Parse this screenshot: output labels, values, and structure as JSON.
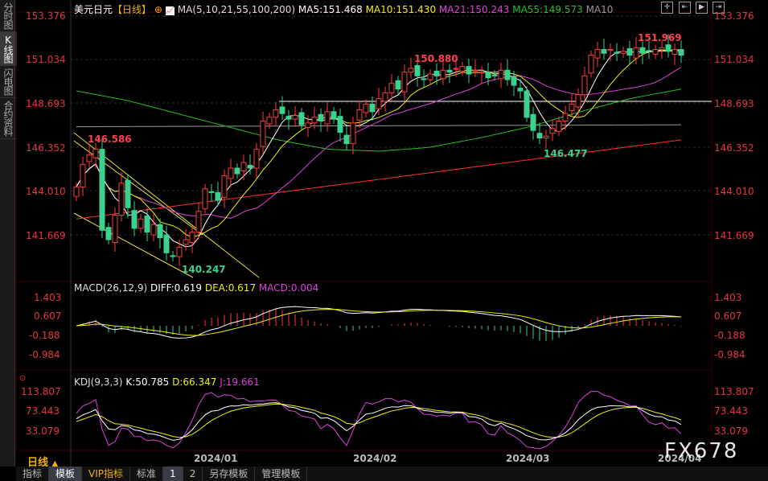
{
  "sidebar": {
    "tabs": [
      "分时图",
      "K线图",
      "闪电图",
      "合约资料"
    ],
    "active": 1
  },
  "header": {
    "symbol": "美元日元",
    "period": "【日线】",
    "ma_label": "MA(5,10,21,55,100,200)",
    "ma5": "MA5:151.468",
    "ma10": "MA10:151.430",
    "ma21": "MA21:150.243",
    "ma55": "MA55:149.573",
    "ma10b": "MA10"
  },
  "price_axis": [
    "153.376",
    "151.034",
    "148.693",
    "146.352",
    "144.010",
    "141.669"
  ],
  "annotations": {
    "high1": "146.586",
    "low1": "140.247",
    "high2": "150.880",
    "low2": "146.477",
    "high3": "151.969"
  },
  "macd": {
    "label": "MACD(26,12,9)",
    "diff": "DIFF:0.619",
    "dea": "DEA:0.617",
    "macd": "MACD:0.004",
    "axis": [
      "1.403",
      "0.607",
      "-0.188",
      "-0.984"
    ]
  },
  "kdj": {
    "label": "KDJ(9,3,3)",
    "k": "K:50.785",
    "d": "D:66.347",
    "j": "J:19.661",
    "axis": [
      "113.807",
      "73.443",
      "33.079"
    ]
  },
  "xaxis": [
    "2024/01",
    "2024/02",
    "2024/03",
    "2024/04"
  ],
  "period_button": "日线",
  "bottom_tabs": [
    "指标",
    "模板",
    "VIP指标",
    "标准",
    "1",
    "2",
    "另存模板",
    "管理模板"
  ],
  "watermark": "FX678",
  "colors": {
    "up": "#ff3b3b",
    "down": "#3ad28e",
    "ma5": "#ffffff",
    "ma10": "#f0f000",
    "ma21": "#e040e0",
    "ma55": "#20c020",
    "ma100": "#ff3030",
    "ma200": "#999999"
  },
  "chart_data": {
    "type": "candlestick",
    "closes": [
      144.3,
      145.5,
      146.0,
      146.3,
      142.0,
      141.5,
      142.8,
      144.5,
      143.2,
      142.1,
      142.6,
      141.9,
      142.3,
      141.6,
      140.8,
      140.6,
      141.1,
      141.5,
      141.9,
      143.0,
      144.2,
      144.0,
      143.6,
      144.9,
      145.3,
      145.0,
      145.6,
      145.3,
      146.3,
      147.8,
      148.0,
      148.4,
      148.2,
      147.9,
      148.1,
      147.6,
      147.7,
      148.0,
      147.8,
      148.3,
      147.9,
      147.2,
      146.6,
      147.7,
      148.4,
      148.7,
      148.3,
      149.0,
      149.3,
      149.8,
      149.5,
      150.4,
      150.6,
      150.2,
      150.0,
      150.3,
      150.2,
      150.5,
      150.4,
      150.6,
      150.7,
      150.3,
      150.5,
      150.4,
      150.1,
      150.2,
      150.5,
      150.0,
      149.7,
      149.4,
      148.0,
      147.3,
      146.9,
      147.0,
      147.4,
      147.8,
      148.2,
      148.7,
      149.2,
      150.2,
      151.3,
      151.6,
      151.4,
      151.6,
      151.4,
      151.5,
      151.3,
      151.7,
      151.4,
      151.5,
      151.6,
      151.7,
      151.5,
      151.6,
      151.3
    ],
    "ma55_points": [
      149.4,
      148.9,
      148.2,
      147.5,
      146.8,
      146.3,
      146.2,
      146.4,
      146.9,
      147.5,
      148.3,
      149.0,
      149.5
    ],
    "ma100_points": [
      142.6,
      146.8
    ],
    "ma200_points": [
      147.5,
      147.6
    ],
    "ylim": [
      141.669,
      153.376
    ]
  }
}
